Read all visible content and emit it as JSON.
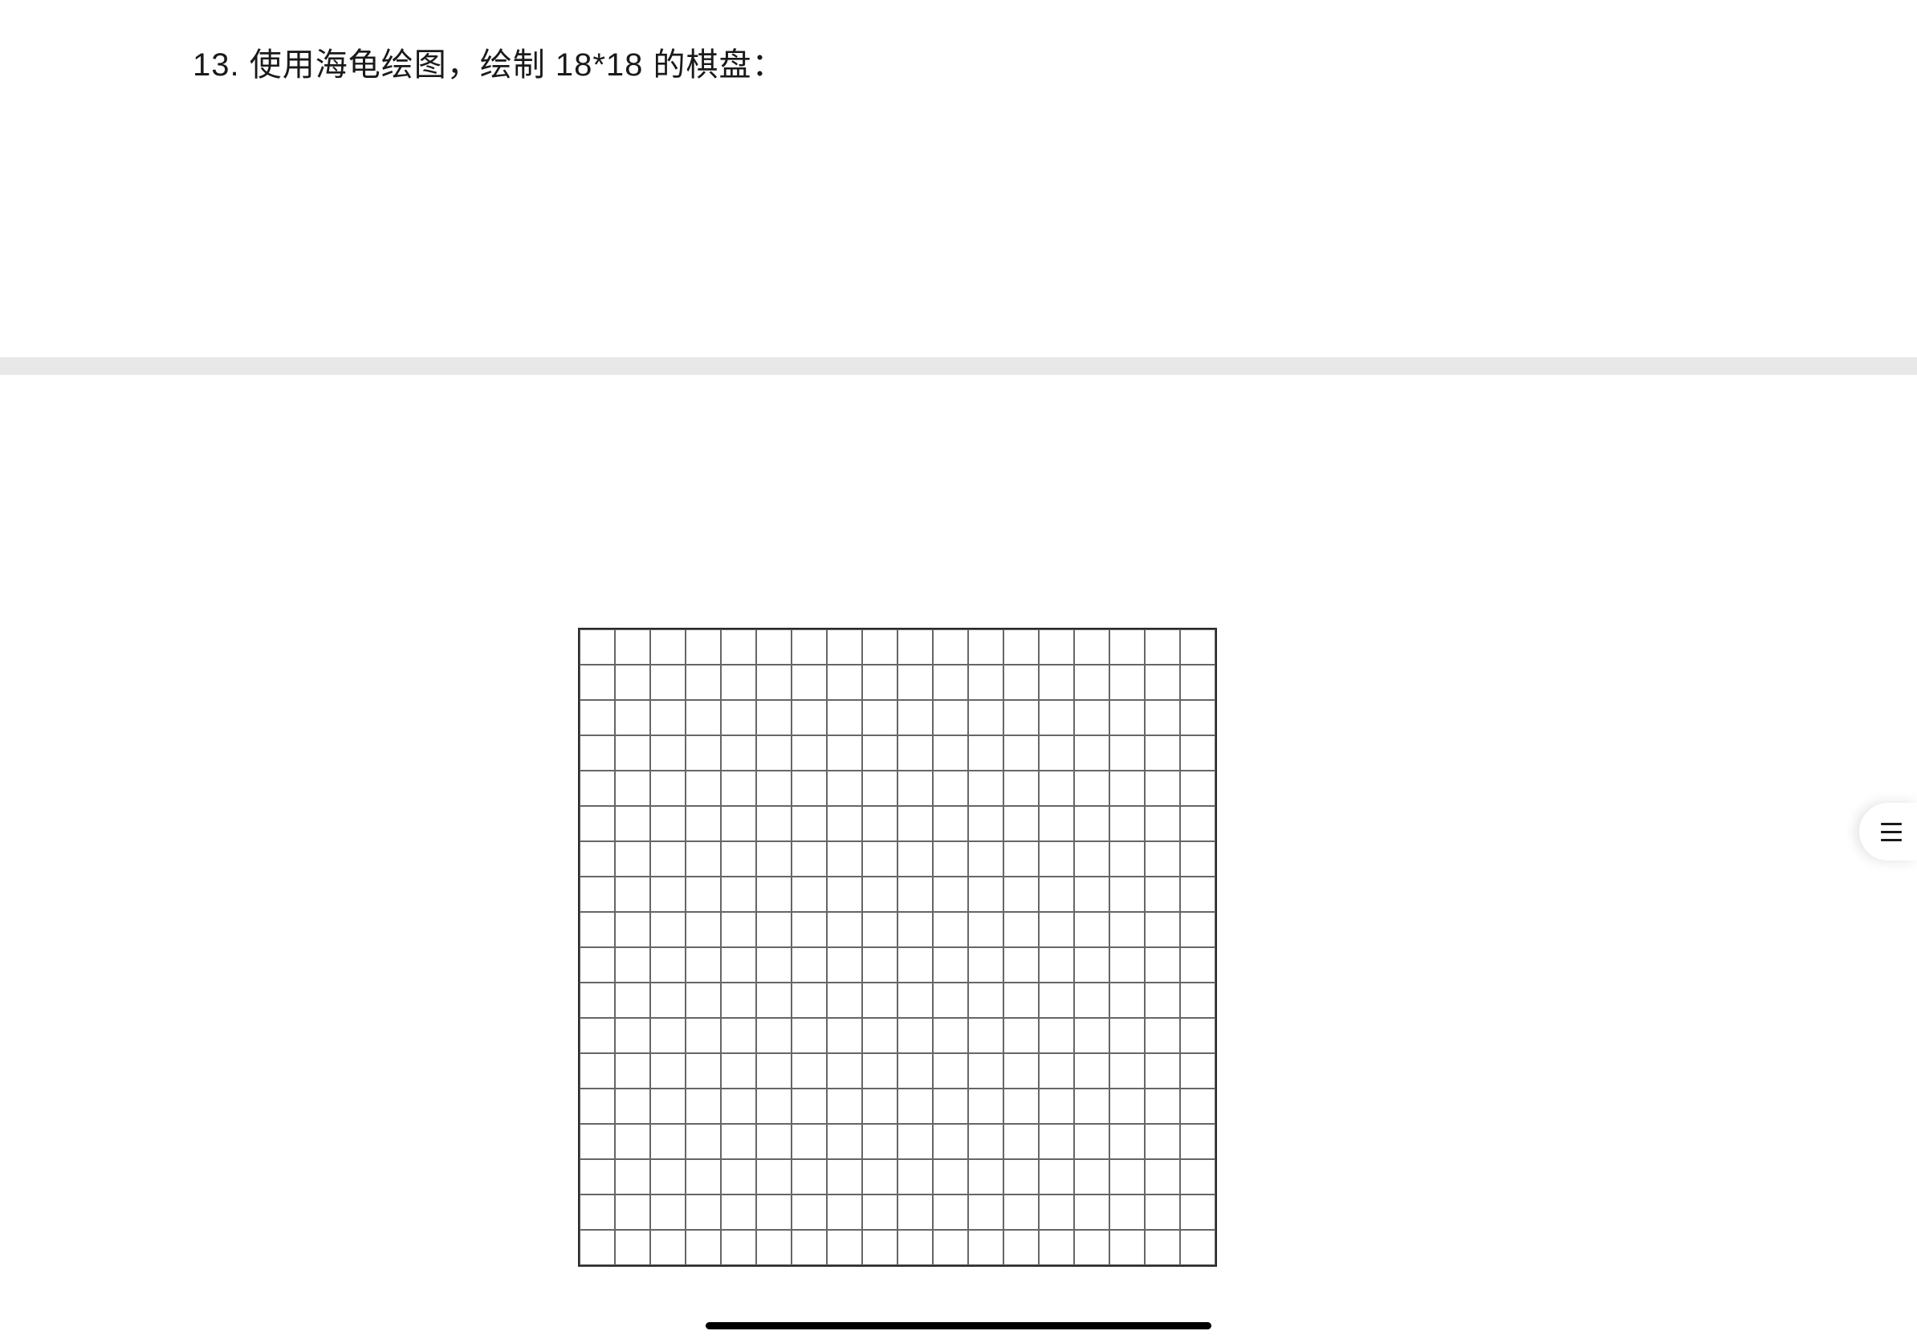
{
  "question": {
    "number": "13.",
    "text": "使用海龟绘图，绘制 18*18 的棋盘："
  },
  "grid": {
    "rows": 18,
    "cols": 18
  },
  "menu": {
    "label": "menu"
  }
}
